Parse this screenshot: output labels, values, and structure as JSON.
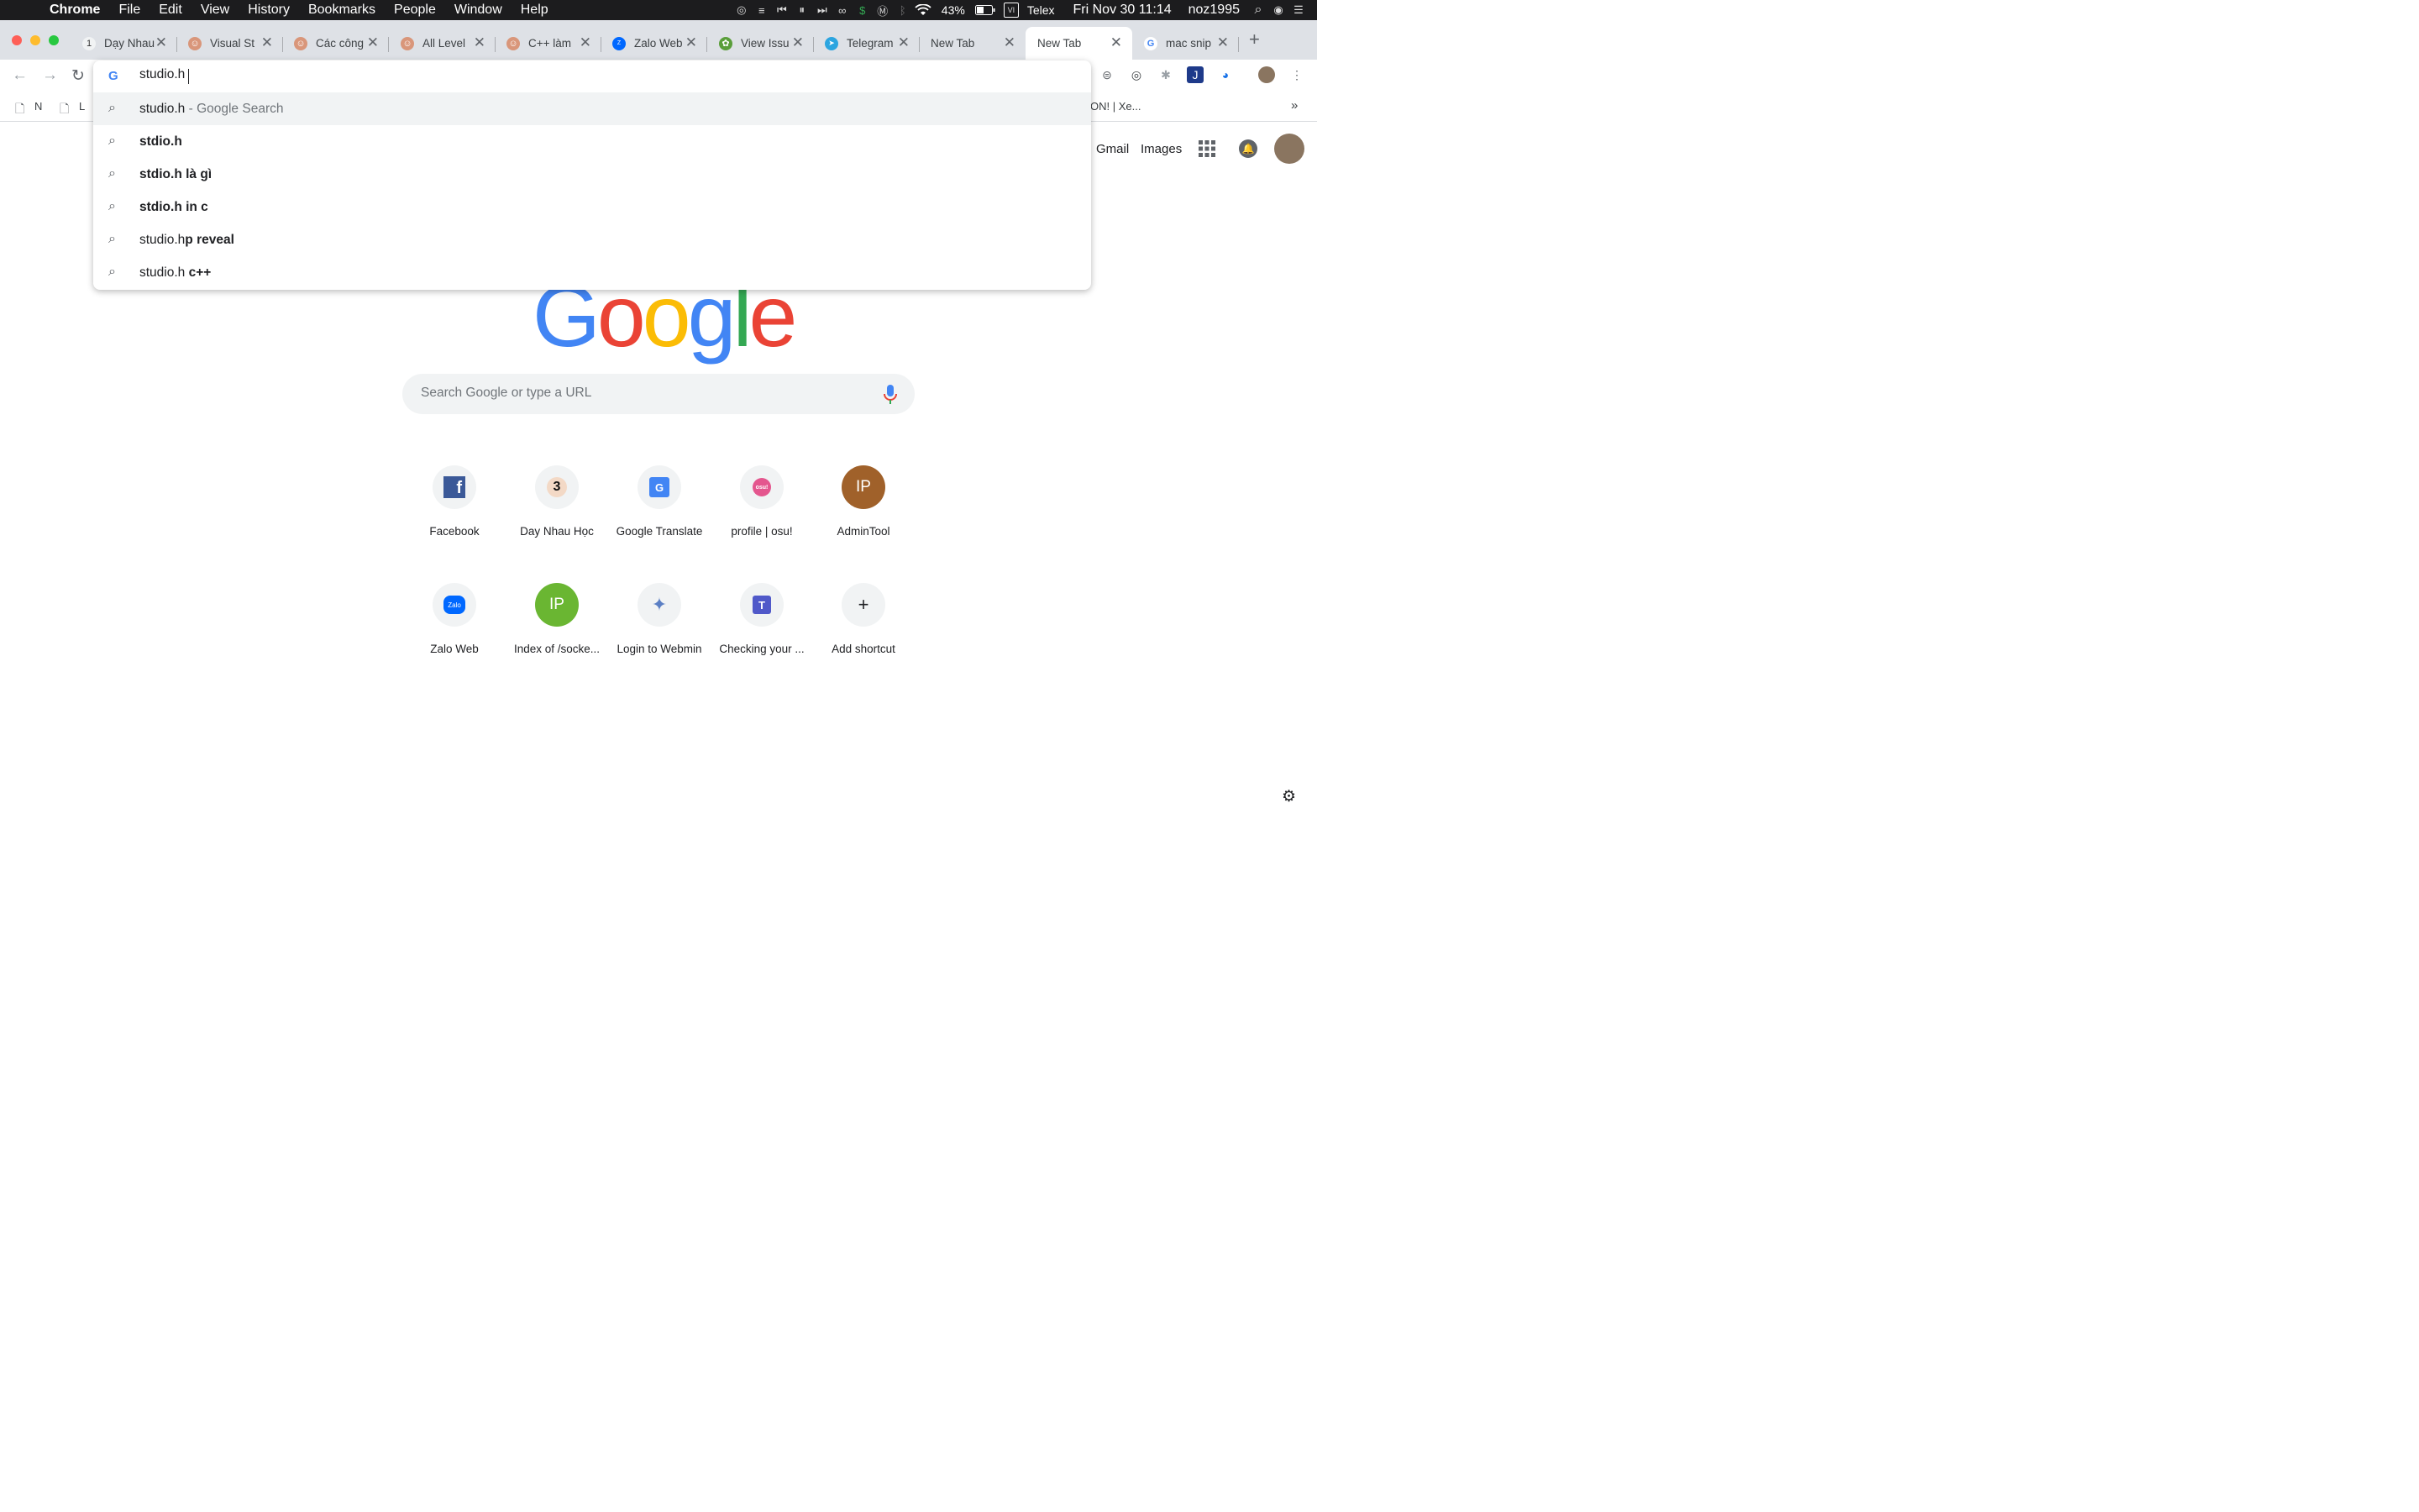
{
  "menubar": {
    "app": "Chrome",
    "items": [
      "File",
      "Edit",
      "View",
      "History",
      "Bookmarks",
      "People",
      "Window",
      "Help"
    ],
    "battery": "43%",
    "input_method": "Telex",
    "datetime": "Fri Nov 30  11:14",
    "user": "noz1995"
  },
  "tabs": [
    {
      "label": "Dạy Nhau",
      "icon": "day-nhau-favicon"
    },
    {
      "label": "Visual St",
      "icon": "avatar-favicon"
    },
    {
      "label": "Các công",
      "icon": "avatar-favicon"
    },
    {
      "label": "All Level",
      "icon": "avatar-favicon"
    },
    {
      "label": "C++ làm",
      "icon": "avatar-favicon"
    },
    {
      "label": "Zalo Web",
      "icon": "zalo-favicon"
    },
    {
      "label": "View Issu",
      "icon": "issue-favicon"
    },
    {
      "label": "Telegram",
      "icon": "telegram-favicon"
    },
    {
      "label": "New Tab",
      "icon": ""
    },
    {
      "label": "New Tab",
      "icon": "",
      "active": true
    },
    {
      "label": "mac snip",
      "icon": "google-favicon"
    }
  ],
  "bookmarks": {
    "items": [
      "N",
      "L"
    ],
    "truncated": "ON! | Xe...",
    "overflow": "»"
  },
  "omnibox": {
    "value": "studio.h",
    "suggestions": [
      {
        "main": "studio.h",
        "bold": "",
        "suffix": " - Google Search",
        "selected": true
      },
      {
        "main": "",
        "bold": "stdio.h",
        "suffix": ""
      },
      {
        "main": "",
        "bold": "stdio.h là gì",
        "suffix": ""
      },
      {
        "main": "",
        "bold": "stdio.h in c",
        "suffix": ""
      },
      {
        "main": "studio.h",
        "bold": "p reveal",
        "suffix": ""
      },
      {
        "main": "studio.h ",
        "bold": "c++",
        "suffix": ""
      }
    ]
  },
  "ntp": {
    "gmail": "Gmail",
    "images": "Images",
    "logo": "Google",
    "search_placeholder": "Search Google or type a URL",
    "shortcuts_row1": [
      {
        "title": "Facebook",
        "icon": "facebook-icon",
        "glyph": "f"
      },
      {
        "title": "Day Nhau Học",
        "icon": "day-nhau-icon",
        "glyph": "3"
      },
      {
        "title": "Google Translate",
        "icon": "translate-icon",
        "glyph": "G"
      },
      {
        "title": "profile | osu!",
        "icon": "osu-icon",
        "glyph": "osu!"
      },
      {
        "title": "AdminTool",
        "icon": "letter-avatar",
        "glyph": "IP"
      }
    ],
    "shortcuts_row2": [
      {
        "title": "Zalo Web",
        "icon": "zalo-icon",
        "glyph": "Zalo"
      },
      {
        "title": "Index of /socke...",
        "icon": "letter-avatar",
        "glyph": "IP"
      },
      {
        "title": "Login to Webmin",
        "icon": "webmin-icon",
        "glyph": "✦"
      },
      {
        "title": "Checking your ...",
        "icon": "teams-icon",
        "glyph": "T"
      },
      {
        "title": "Add shortcut",
        "icon": "plus-icon",
        "glyph": "+"
      }
    ]
  },
  "colors": {
    "blue": "#4285f4",
    "red": "#ea4335",
    "yellow": "#fbbc05",
    "green": "#34a853",
    "tabstrip": "#dee1e6"
  }
}
